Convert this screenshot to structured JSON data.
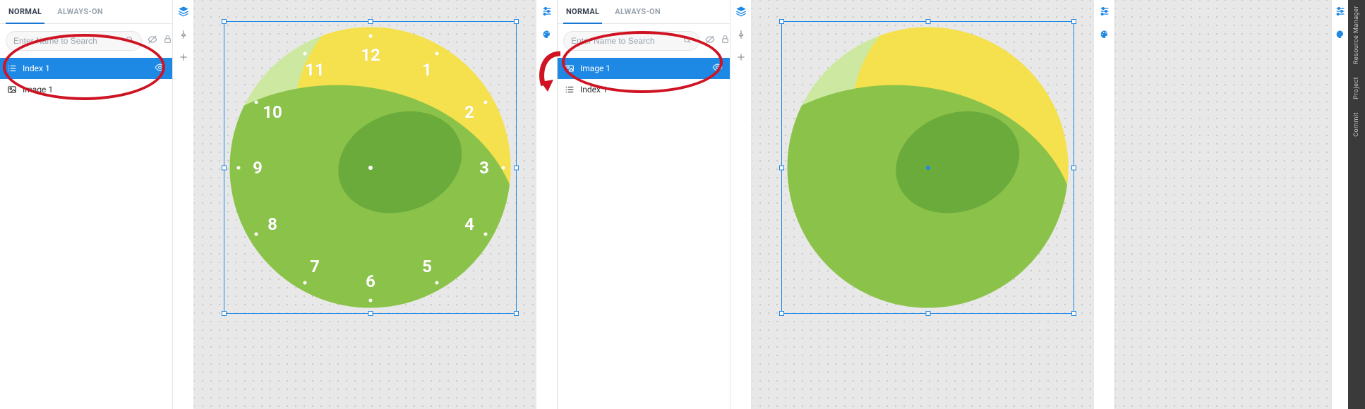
{
  "tabs": {
    "normal": "NORMAL",
    "always_on": "ALWAYS-ON",
    "active": "normal"
  },
  "search": {
    "placeholder": "Enter Name to Search"
  },
  "left_panel": {
    "layers": [
      {
        "label": "Index 1",
        "type": "index",
        "selected": true
      },
      {
        "label": "Image 1",
        "type": "image",
        "selected": false
      }
    ]
  },
  "right_panel": {
    "layers": [
      {
        "label": "Image 1",
        "type": "image",
        "selected": true
      },
      {
        "label": "Index 1",
        "type": "index",
        "selected": false
      }
    ]
  },
  "clock": {
    "numbers": [
      "12",
      "1",
      "2",
      "3",
      "4",
      "5",
      "6",
      "7",
      "8",
      "9",
      "10",
      "11"
    ]
  },
  "colors": {
    "primary": "#1e88e5",
    "annotation": "#cf1322",
    "ball_green": "#8bc34a",
    "ball_yellow": "#f5e04d",
    "ball_light": "#cde9a1",
    "ball_dark": "#6bab3b"
  },
  "extras": {
    "items": [
      "Resource Manager",
      "Project",
      "Commit"
    ]
  }
}
